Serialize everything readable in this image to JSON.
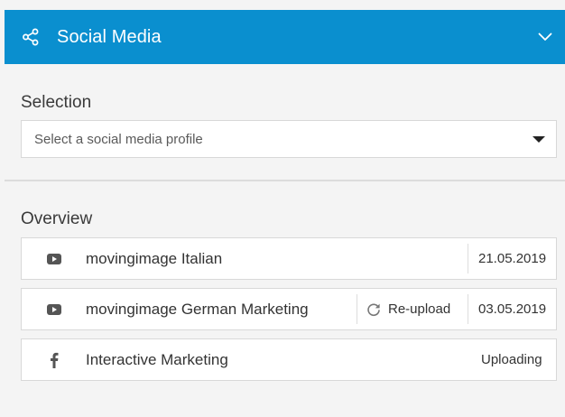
{
  "header": {
    "title": "Social Media",
    "left_icon": "share-icon",
    "right_icon": "chevron-down-icon"
  },
  "selection": {
    "label": "Selection",
    "placeholder": "Select a social media profile"
  },
  "overview": {
    "label": "Overview",
    "rows": [
      {
        "icon": "youtube-icon",
        "name": "movingimage Italian",
        "status": "21.05.2019"
      },
      {
        "icon": "youtube-icon",
        "name": "movingimage German Marketing",
        "action_label": "Re-upload",
        "status": "03.05.2019"
      },
      {
        "icon": "facebook-icon",
        "name": "Interactive Marketing",
        "status": "Uploading"
      }
    ]
  },
  "colors": {
    "header_bg": "#0a8fcf",
    "page_bg": "#f4f4f4",
    "row_bg": "#ffffff"
  }
}
